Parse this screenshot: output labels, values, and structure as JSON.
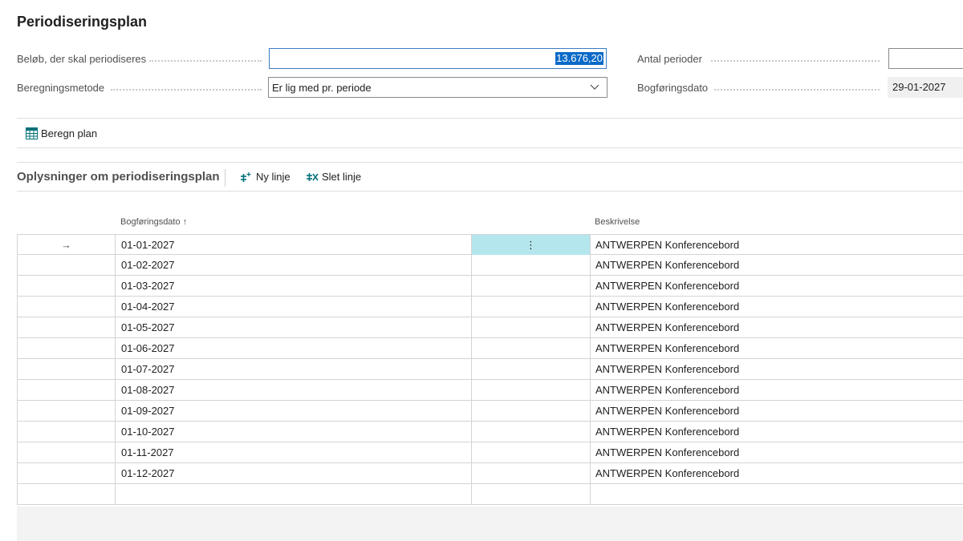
{
  "page": {
    "title": "Periodiseringsplan"
  },
  "fields": {
    "amount_label": "Beløb, der skal periodiseres",
    "amount_value": "13.676,20",
    "method_label": "Beregningsmetode",
    "method_value": "Er lig med pr. periode",
    "periods_label": "Antal perioder",
    "periods_value": "",
    "posting_date_label": "Bogføringsdato",
    "posting_date_value": "29-01-2027"
  },
  "actions": {
    "calculate_plan": "Beregn plan"
  },
  "lines_section": {
    "title": "Oplysninger om periodiseringsplan",
    "new_line": "Ny linje",
    "delete_line": "Slet linje"
  },
  "table": {
    "headers": {
      "posting_date": "Bogføringsdato",
      "description": "Beskrivelse"
    },
    "sort_indicator": "↑",
    "row_marker": "→",
    "menu_glyph": "⋮",
    "rows": [
      {
        "date": "01-01-2027",
        "description": "ANTWERPEN Konferencebord"
      },
      {
        "date": "01-02-2027",
        "description": "ANTWERPEN Konferencebord"
      },
      {
        "date": "01-03-2027",
        "description": "ANTWERPEN Konferencebord"
      },
      {
        "date": "01-04-2027",
        "description": "ANTWERPEN Konferencebord"
      },
      {
        "date": "01-05-2027",
        "description": "ANTWERPEN Konferencebord"
      },
      {
        "date": "01-06-2027",
        "description": "ANTWERPEN Konferencebord"
      },
      {
        "date": "01-07-2027",
        "description": "ANTWERPEN Konferencebord"
      },
      {
        "date": "01-08-2027",
        "description": "ANTWERPEN Konferencebord"
      },
      {
        "date": "01-09-2027",
        "description": "ANTWERPEN Konferencebord"
      },
      {
        "date": "01-10-2027",
        "description": "ANTWERPEN Konferencebord"
      },
      {
        "date": "01-11-2027",
        "description": "ANTWERPEN Konferencebord"
      },
      {
        "date": "01-12-2027",
        "description": "ANTWERPEN Konferencebord"
      }
    ]
  },
  "icons": {
    "calculate": "calculator-grid-icon",
    "new_line": "new-line-icon",
    "delete_line": "delete-line-icon",
    "dropdown": "chevron-down-icon"
  },
  "colors": {
    "accent": "#0b6ac7",
    "active_cell": "#b4e6ee",
    "icon_teal": "#00707a"
  }
}
